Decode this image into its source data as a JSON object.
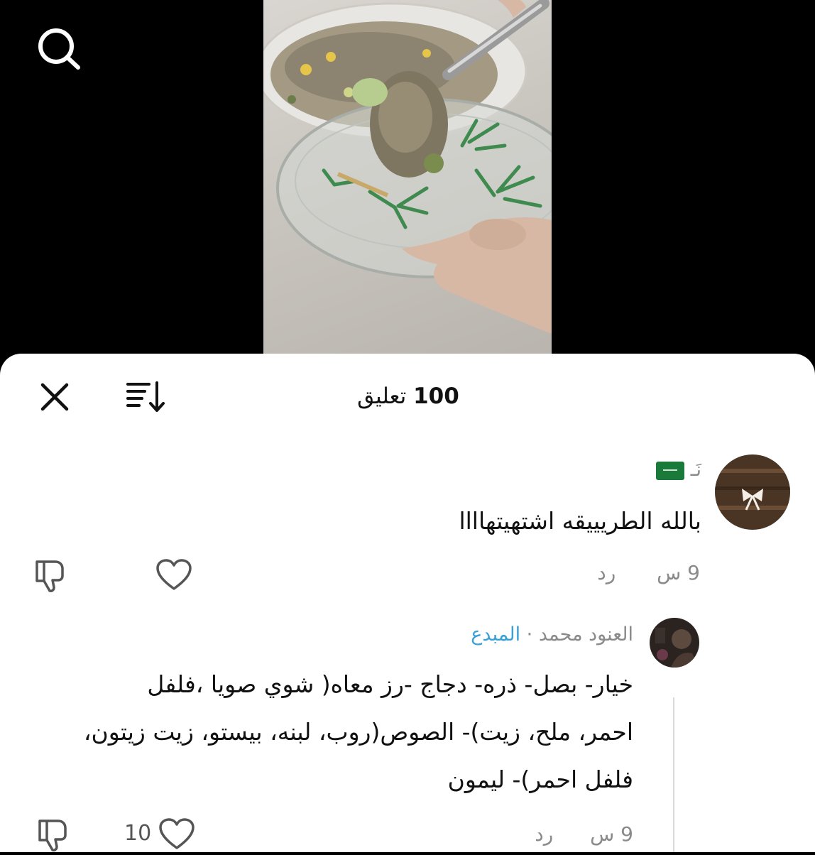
{
  "header": {
    "search_icon": "search-icon"
  },
  "sheet": {
    "count": "100",
    "label": "تعليق",
    "close_icon": "close-icon",
    "sort_icon": "sort-icon"
  },
  "comments": [
    {
      "name": "نَـ",
      "flag_icon": "saudi-flag-icon",
      "text": "بالله الطريييقه اشتهيتهاااا",
      "time": "9 س",
      "reply": "رد",
      "like_icon": "heart-icon",
      "dislike_icon": "thumbs-down-icon"
    },
    {
      "name": "العنود محمد",
      "separator": "·",
      "badge": "المبدع",
      "text_lines": [
        "خيار- بصل- ذره- دجاج -رز معاه( شوي صويا ،فلفل",
        "احمر، ملح، زيت)- الصوص(روب، لبنه، بيستو، زيت زيتون،",
        "فلفل احمر)- ليمون"
      ],
      "time": "9 س",
      "reply": "رد",
      "likes": "10",
      "like_icon": "heart-icon",
      "dislike_icon": "thumbs-down-icon"
    }
  ],
  "colors": {
    "badge": "#3aa0d8",
    "muted": "#8a8a8a"
  }
}
